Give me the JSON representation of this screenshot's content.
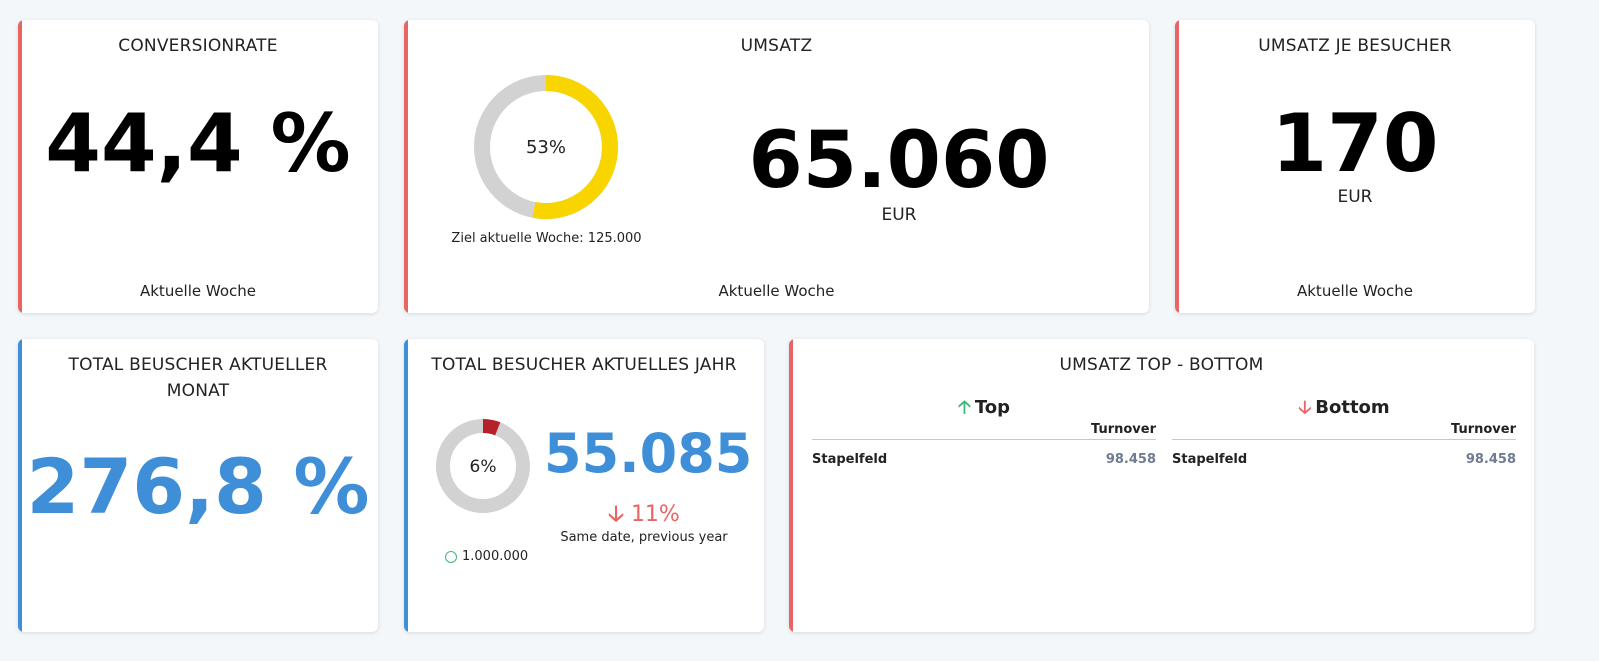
{
  "colors": {
    "accent_red": "#e96464",
    "accent_blue": "#3f8fd8",
    "gauge_yellow": "#f9d500",
    "gauge_gray": "#d2d2d2",
    "gauge_red": "#b5202b",
    "down_red": "#e96464",
    "up_green": "#3cb878",
    "value_blue": "#3f8fd8"
  },
  "conversion": {
    "title": "CONVERSIONRATE",
    "value": "44,4 %",
    "footer": "Aktuelle Woche"
  },
  "umsatz": {
    "title": "UMSATZ",
    "gauge_percent": 53,
    "gauge_label": "53%",
    "target_caption": "Ziel aktuelle Woche: 125.000",
    "value": "65.060",
    "unit": "EUR",
    "footer": "Aktuelle Woche"
  },
  "umsatz_je_besucher": {
    "title": "UMSATZ JE BESUCHER",
    "value": "170",
    "unit": "EUR",
    "footer": "Aktuelle Woche"
  },
  "total_monat": {
    "title_line1": "TOTAL BEUSCHER AKTUELLER",
    "title_line2": "MONAT",
    "value": "276,8 %"
  },
  "total_jahr": {
    "title": "TOTAL BESUCHER AKTUELLES JAHR",
    "gauge_percent": 6,
    "gauge_label": "6%",
    "target": "1.000.000",
    "value": "55.085",
    "change_arrow": "down-arrow-icon",
    "change": "11%",
    "change_caption": "Same date, previous year"
  },
  "top_bottom": {
    "title": "UMSATZ TOP - BOTTOM",
    "top": {
      "heading": "Top",
      "column": "Turnover",
      "rows": [
        {
          "name": "Stapelfeld",
          "value": "98.458"
        }
      ]
    },
    "bottom": {
      "heading": "Bottom",
      "column": "Turnover",
      "rows": [
        {
          "name": "Stapelfeld",
          "value": "98.458"
        }
      ]
    }
  }
}
